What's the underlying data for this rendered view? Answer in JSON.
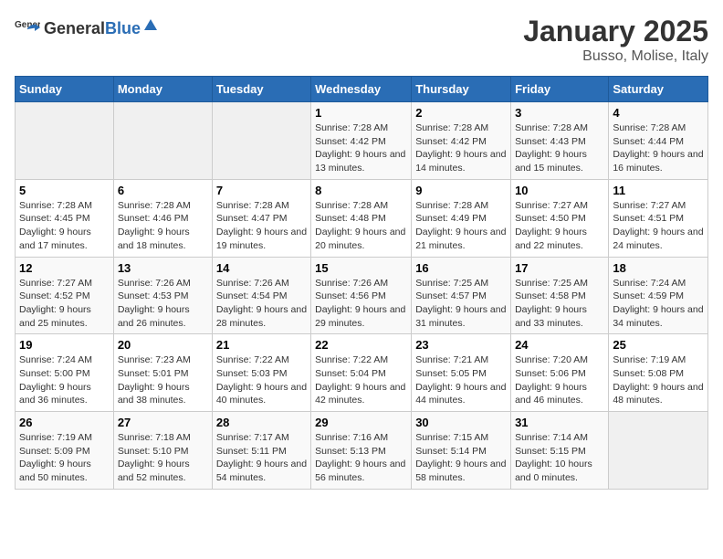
{
  "header": {
    "logo_general": "General",
    "logo_blue": "Blue",
    "month": "January 2025",
    "location": "Busso, Molise, Italy"
  },
  "weekdays": [
    "Sunday",
    "Monday",
    "Tuesday",
    "Wednesday",
    "Thursday",
    "Friday",
    "Saturday"
  ],
  "weeks": [
    [
      {
        "day": "",
        "sunrise": "",
        "sunset": "",
        "daylight": ""
      },
      {
        "day": "",
        "sunrise": "",
        "sunset": "",
        "daylight": ""
      },
      {
        "day": "",
        "sunrise": "",
        "sunset": "",
        "daylight": ""
      },
      {
        "day": "1",
        "sunrise": "Sunrise: 7:28 AM",
        "sunset": "Sunset: 4:42 PM",
        "daylight": "Daylight: 9 hours and 13 minutes."
      },
      {
        "day": "2",
        "sunrise": "Sunrise: 7:28 AM",
        "sunset": "Sunset: 4:42 PM",
        "daylight": "Daylight: 9 hours and 14 minutes."
      },
      {
        "day": "3",
        "sunrise": "Sunrise: 7:28 AM",
        "sunset": "Sunset: 4:43 PM",
        "daylight": "Daylight: 9 hours and 15 minutes."
      },
      {
        "day": "4",
        "sunrise": "Sunrise: 7:28 AM",
        "sunset": "Sunset: 4:44 PM",
        "daylight": "Daylight: 9 hours and 16 minutes."
      }
    ],
    [
      {
        "day": "5",
        "sunrise": "Sunrise: 7:28 AM",
        "sunset": "Sunset: 4:45 PM",
        "daylight": "Daylight: 9 hours and 17 minutes."
      },
      {
        "day": "6",
        "sunrise": "Sunrise: 7:28 AM",
        "sunset": "Sunset: 4:46 PM",
        "daylight": "Daylight: 9 hours and 18 minutes."
      },
      {
        "day": "7",
        "sunrise": "Sunrise: 7:28 AM",
        "sunset": "Sunset: 4:47 PM",
        "daylight": "Daylight: 9 hours and 19 minutes."
      },
      {
        "day": "8",
        "sunrise": "Sunrise: 7:28 AM",
        "sunset": "Sunset: 4:48 PM",
        "daylight": "Daylight: 9 hours and 20 minutes."
      },
      {
        "day": "9",
        "sunrise": "Sunrise: 7:28 AM",
        "sunset": "Sunset: 4:49 PM",
        "daylight": "Daylight: 9 hours and 21 minutes."
      },
      {
        "day": "10",
        "sunrise": "Sunrise: 7:27 AM",
        "sunset": "Sunset: 4:50 PM",
        "daylight": "Daylight: 9 hours and 22 minutes."
      },
      {
        "day": "11",
        "sunrise": "Sunrise: 7:27 AM",
        "sunset": "Sunset: 4:51 PM",
        "daylight": "Daylight: 9 hours and 24 minutes."
      }
    ],
    [
      {
        "day": "12",
        "sunrise": "Sunrise: 7:27 AM",
        "sunset": "Sunset: 4:52 PM",
        "daylight": "Daylight: 9 hours and 25 minutes."
      },
      {
        "day": "13",
        "sunrise": "Sunrise: 7:26 AM",
        "sunset": "Sunset: 4:53 PM",
        "daylight": "Daylight: 9 hours and 26 minutes."
      },
      {
        "day": "14",
        "sunrise": "Sunrise: 7:26 AM",
        "sunset": "Sunset: 4:54 PM",
        "daylight": "Daylight: 9 hours and 28 minutes."
      },
      {
        "day": "15",
        "sunrise": "Sunrise: 7:26 AM",
        "sunset": "Sunset: 4:56 PM",
        "daylight": "Daylight: 9 hours and 29 minutes."
      },
      {
        "day": "16",
        "sunrise": "Sunrise: 7:25 AM",
        "sunset": "Sunset: 4:57 PM",
        "daylight": "Daylight: 9 hours and 31 minutes."
      },
      {
        "day": "17",
        "sunrise": "Sunrise: 7:25 AM",
        "sunset": "Sunset: 4:58 PM",
        "daylight": "Daylight: 9 hours and 33 minutes."
      },
      {
        "day": "18",
        "sunrise": "Sunrise: 7:24 AM",
        "sunset": "Sunset: 4:59 PM",
        "daylight": "Daylight: 9 hours and 34 minutes."
      }
    ],
    [
      {
        "day": "19",
        "sunrise": "Sunrise: 7:24 AM",
        "sunset": "Sunset: 5:00 PM",
        "daylight": "Daylight: 9 hours and 36 minutes."
      },
      {
        "day": "20",
        "sunrise": "Sunrise: 7:23 AM",
        "sunset": "Sunset: 5:01 PM",
        "daylight": "Daylight: 9 hours and 38 minutes."
      },
      {
        "day": "21",
        "sunrise": "Sunrise: 7:22 AM",
        "sunset": "Sunset: 5:03 PM",
        "daylight": "Daylight: 9 hours and 40 minutes."
      },
      {
        "day": "22",
        "sunrise": "Sunrise: 7:22 AM",
        "sunset": "Sunset: 5:04 PM",
        "daylight": "Daylight: 9 hours and 42 minutes."
      },
      {
        "day": "23",
        "sunrise": "Sunrise: 7:21 AM",
        "sunset": "Sunset: 5:05 PM",
        "daylight": "Daylight: 9 hours and 44 minutes."
      },
      {
        "day": "24",
        "sunrise": "Sunrise: 7:20 AM",
        "sunset": "Sunset: 5:06 PM",
        "daylight": "Daylight: 9 hours and 46 minutes."
      },
      {
        "day": "25",
        "sunrise": "Sunrise: 7:19 AM",
        "sunset": "Sunset: 5:08 PM",
        "daylight": "Daylight: 9 hours and 48 minutes."
      }
    ],
    [
      {
        "day": "26",
        "sunrise": "Sunrise: 7:19 AM",
        "sunset": "Sunset: 5:09 PM",
        "daylight": "Daylight: 9 hours and 50 minutes."
      },
      {
        "day": "27",
        "sunrise": "Sunrise: 7:18 AM",
        "sunset": "Sunset: 5:10 PM",
        "daylight": "Daylight: 9 hours and 52 minutes."
      },
      {
        "day": "28",
        "sunrise": "Sunrise: 7:17 AM",
        "sunset": "Sunset: 5:11 PM",
        "daylight": "Daylight: 9 hours and 54 minutes."
      },
      {
        "day": "29",
        "sunrise": "Sunrise: 7:16 AM",
        "sunset": "Sunset: 5:13 PM",
        "daylight": "Daylight: 9 hours and 56 minutes."
      },
      {
        "day": "30",
        "sunrise": "Sunrise: 7:15 AM",
        "sunset": "Sunset: 5:14 PM",
        "daylight": "Daylight: 9 hours and 58 minutes."
      },
      {
        "day": "31",
        "sunrise": "Sunrise: 7:14 AM",
        "sunset": "Sunset: 5:15 PM",
        "daylight": "Daylight: 10 hours and 0 minutes."
      },
      {
        "day": "",
        "sunrise": "",
        "sunset": "",
        "daylight": ""
      }
    ]
  ]
}
